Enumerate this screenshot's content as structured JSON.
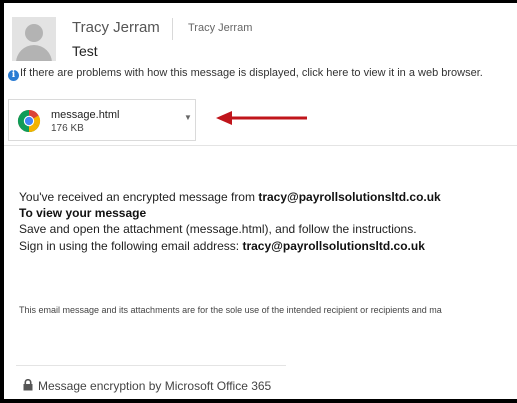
{
  "header": {
    "from_name": "Tracy Jerram",
    "to_name": "Tracy Jerram",
    "subject": "Test"
  },
  "info_bar": {
    "icon": "info-icon",
    "text": "If there are problems with how this message is displayed, click here to view it in a web browser."
  },
  "attachment": {
    "icon": "chrome-icon",
    "name": "message.html",
    "size": "176 KB"
  },
  "body": {
    "line1_prefix": "You've received an encrypted message from ",
    "line1_email": "tracy@payrollsolutionsltd.co.uk",
    "line2": "To view your message",
    "line3": "Save and open the attachment (message.html), and follow the instructions.",
    "line4_prefix": "Sign in using the following email address: ",
    "line4_email": "tracy@payrollsolutionsltd.co.uk",
    "disclaimer": "This email message and its attachments are for the sole use of the intended recipient or recipients and ma"
  },
  "footer": {
    "icon": "lock-icon",
    "text": "Message encryption by Microsoft Office 365"
  },
  "colors": {
    "annotation_arrow": "#c0151b",
    "info_blue": "#2b7cd3"
  }
}
